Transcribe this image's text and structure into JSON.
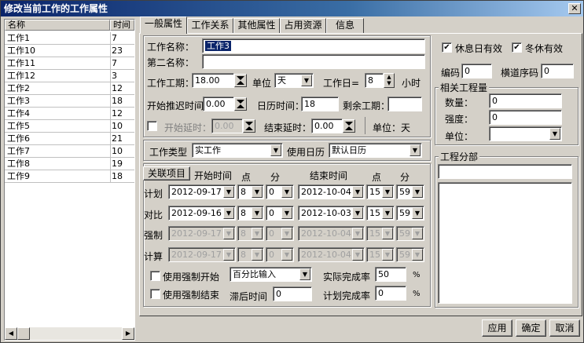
{
  "window": {
    "title": "修改当前工作的工作属性"
  },
  "task_list": {
    "headers": [
      "名称",
      "时间"
    ],
    "rows": [
      {
        "name": "工作1",
        "time": "7"
      },
      {
        "name": "工作10",
        "time": "23"
      },
      {
        "name": "工作11",
        "time": "7"
      },
      {
        "name": "工作12",
        "time": "3"
      },
      {
        "name": "工作2",
        "time": "12"
      },
      {
        "name": "工作3",
        "time": "18"
      },
      {
        "name": "工作4",
        "time": "12"
      },
      {
        "name": "工作5",
        "time": "10"
      },
      {
        "name": "工作6",
        "time": "21"
      },
      {
        "name": "工作7",
        "time": "10"
      },
      {
        "name": "工作8",
        "time": "19"
      },
      {
        "name": "工作9",
        "time": "18"
      }
    ]
  },
  "tabs": [
    "一般属性",
    "工作关系",
    "其他属性",
    "占用资源",
    "信息"
  ],
  "general": {
    "name_label": "工作名称：",
    "name_value": "工作3",
    "name2_label": "第二名称：",
    "name2_value": "",
    "duration_label": "工作工期：",
    "duration_value": "18.00",
    "unit_label": "单位",
    "unit_value": "天",
    "workday_label": "工作日=",
    "workday_value": "8",
    "hours_label": "小时",
    "start_delay_label": "开始推迟时间",
    "start_delay_value": "0.00",
    "calendar_time_label": "日历时间：",
    "calendar_time_value": "18",
    "remaining_label": "剩余工期：",
    "remaining_value": "",
    "start_lag_label": "开始延时：",
    "start_lag_value": "0.00",
    "end_lag_label": "结束延时：",
    "end_lag_value": "0.00",
    "lag_unit_text": "单位：天",
    "type_label": "工作类型",
    "type_value": "实工作",
    "calendar_label": "使用日历",
    "calendar_value": "默认日历"
  },
  "schedule": {
    "related_button": "关联项目",
    "col_start_time": "开始时间",
    "col_hour1": "点",
    "col_min1": "分",
    "col_end_time": "结束时间",
    "col_hour2": "点",
    "col_min2": "分",
    "rows": [
      {
        "label": "计划",
        "start": "2012-09-17",
        "sh": "8",
        "sm": "0",
        "end": "2012-10-04",
        "eh": "15",
        "em": "59"
      },
      {
        "label": "对比",
        "start": "2012-09-16",
        "sh": "8",
        "sm": "0",
        "end": "2012-10-03",
        "eh": "15",
        "em": "59"
      },
      {
        "label": "强制",
        "start": "2012-09-17",
        "sh": "8",
        "sm": "0",
        "end": "2012-10-04",
        "eh": "15",
        "em": "59"
      },
      {
        "label": "计算",
        "start": "2012-09-17",
        "sh": "8",
        "sm": "0",
        "end": "2012-10-04",
        "eh": "15",
        "em": "59"
      }
    ],
    "force_start_label": "使用强制开始",
    "force_end_label": "使用强制结束",
    "input_mode_value": "百分比输入",
    "lag_time_label": "滞后时间",
    "lag_time_value": "0",
    "actual_pct_label": "实际完成率",
    "actual_pct_value": "50",
    "plan_pct_label": "计划完成率",
    "plan_pct_value": "0",
    "pct_sign": "%"
  },
  "right": {
    "rest_day_label": "休息日有效",
    "winter_label": "冬休有效",
    "code_label": "编码",
    "code_value": "0",
    "order_label": "横道序码",
    "order_value": "0",
    "quantity_group": "相关工程量",
    "qty_label": "数量：",
    "qty_value": "0",
    "intensity_label": "强度：",
    "intensity_value": "0",
    "unit_label": "单位：",
    "unit_value": "",
    "division_group": "工程分部",
    "division_value": ""
  },
  "buttons": {
    "apply": "应用",
    "ok": "确定",
    "cancel": "取消"
  },
  "colors": {
    "title_start": "#0a246a",
    "title_end": "#a6caf0",
    "selection": "#0a246a"
  }
}
